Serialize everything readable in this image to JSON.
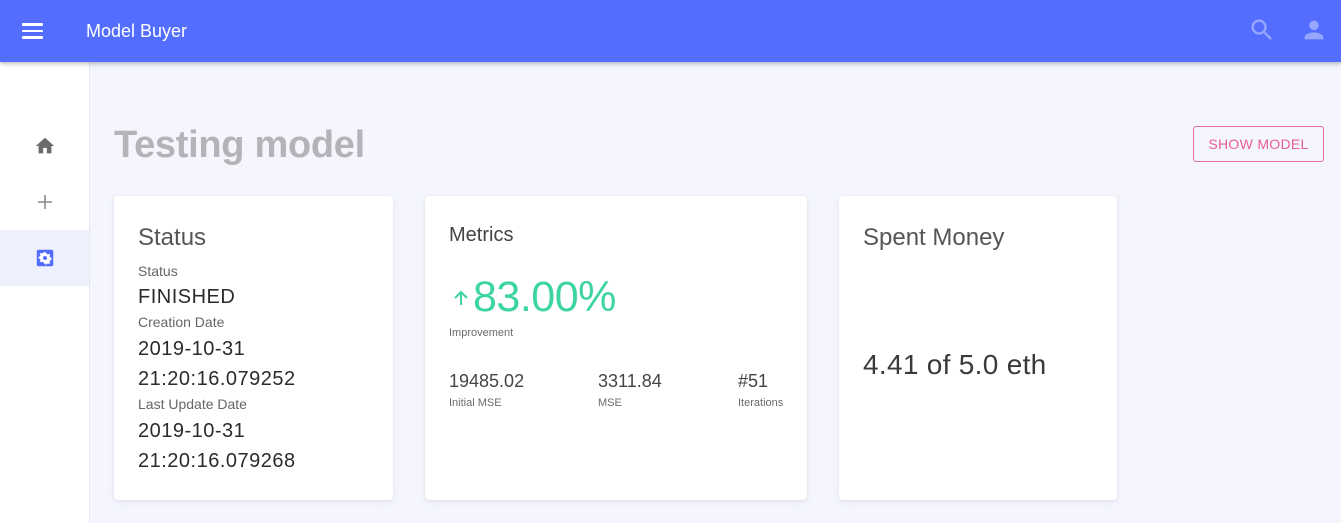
{
  "app": {
    "title": "Model Buyer"
  },
  "icons": {
    "menu": "menu-icon",
    "search": "search-icon",
    "user": "account-icon",
    "home": "home-icon",
    "add": "plus-icon",
    "settings": "settings-icon",
    "trend": "arrow-up-icon"
  },
  "page": {
    "title": "Testing model",
    "show_model_label": "SHOW MODEL"
  },
  "status_card": {
    "title": "Status",
    "status_label": "Status",
    "status_value": "FINISHED",
    "creation_label": "Creation Date",
    "creation_date": "2019-10-31",
    "creation_time": "21:20:16.079252",
    "update_label": "Last Update Date",
    "update_date": "2019-10-31",
    "update_time": "21:20:16.079268"
  },
  "metrics_card": {
    "title": "Metrics",
    "improvement_value": "83.00%",
    "improvement_label": "Improvement",
    "initial_mse_value": "19485.02",
    "initial_mse_label": "Initial MSE",
    "mse_value": "3311.84",
    "mse_label": "MSE",
    "iterations_value": "#51",
    "iterations_label": "Iterations"
  },
  "money_card": {
    "title": "Spent Money",
    "value": "4.41 of 5.0 eth"
  },
  "colors": {
    "appbar": "#536dfe",
    "accent_pink": "#e8608f",
    "improvement_green": "#3cd4a0",
    "active_nav_icon": "#536dfe"
  }
}
